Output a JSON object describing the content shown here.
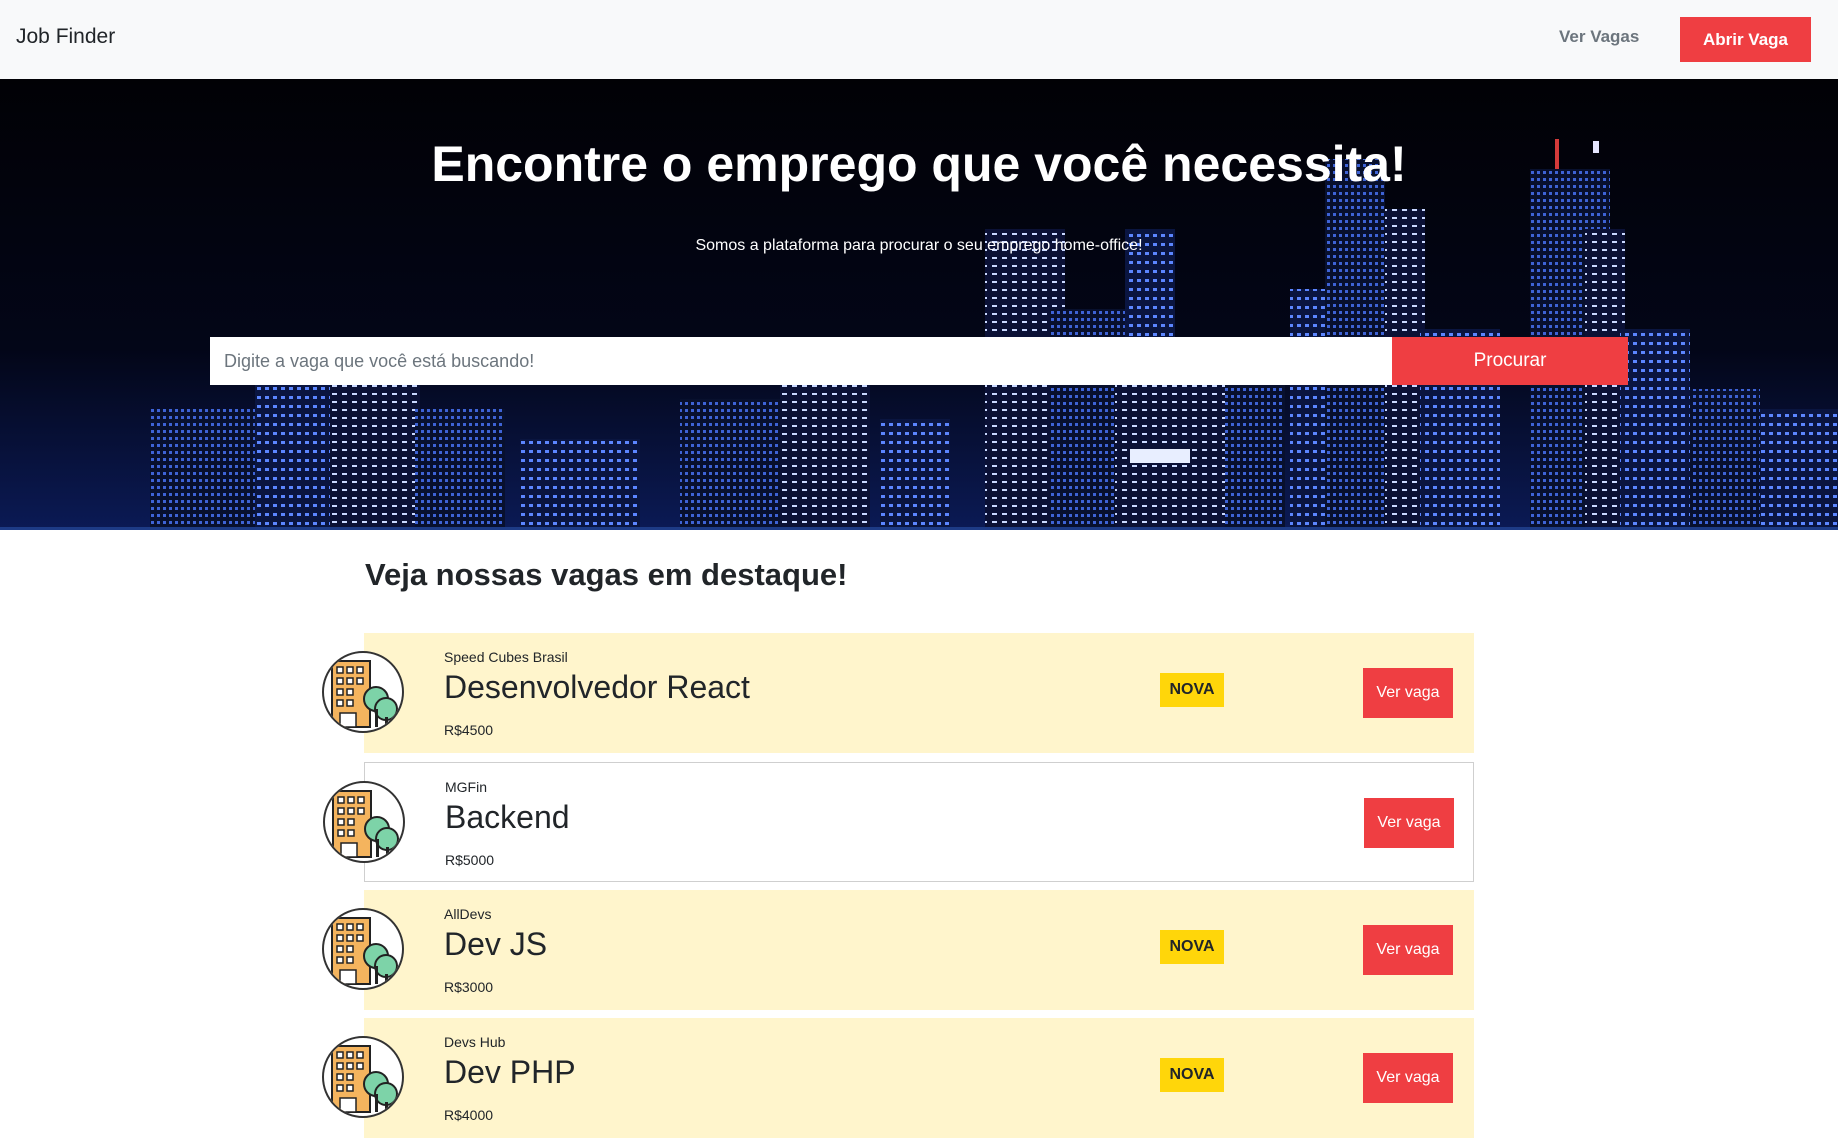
{
  "navbar": {
    "brand": "Job Finder",
    "link_label": "Ver Vagas",
    "button_label": "Abrir Vaga"
  },
  "hero": {
    "title": "Encontre o emprego que você necessita!",
    "subtitle": "Somos a plataforma para procurar o seu emprego home-office!",
    "search_placeholder": "Digite a vaga que você está buscando!",
    "search_value": "",
    "search_button": "Procurar"
  },
  "section": {
    "title": "Veja nossas vagas em destaque!"
  },
  "jobs": [
    {
      "company": "Speed Cubes Brasil",
      "title": "Desenvolvedor React",
      "salary": "R$4500",
      "badge": "NOVA",
      "button": "Ver vaga"
    },
    {
      "company": "MGFin",
      "title": "Backend",
      "salary": "R$5000",
      "badge": "",
      "button": "Ver vaga"
    },
    {
      "company": "AllDevs",
      "title": "Dev JS",
      "salary": "R$3000",
      "badge": "NOVA",
      "button": "Ver vaga"
    },
    {
      "company": "Devs Hub",
      "title": "Dev PHP",
      "salary": "R$4000",
      "badge": "NOVA",
      "button": "Ver vaga"
    }
  ],
  "colors": {
    "accent": "#ef3e42",
    "featured_bg": "#fff5cc",
    "badge": "#ffd60a",
    "navbar_bg": "#f8f9fa"
  },
  "icons": {
    "company_logo": "building-with-trees-icon"
  }
}
